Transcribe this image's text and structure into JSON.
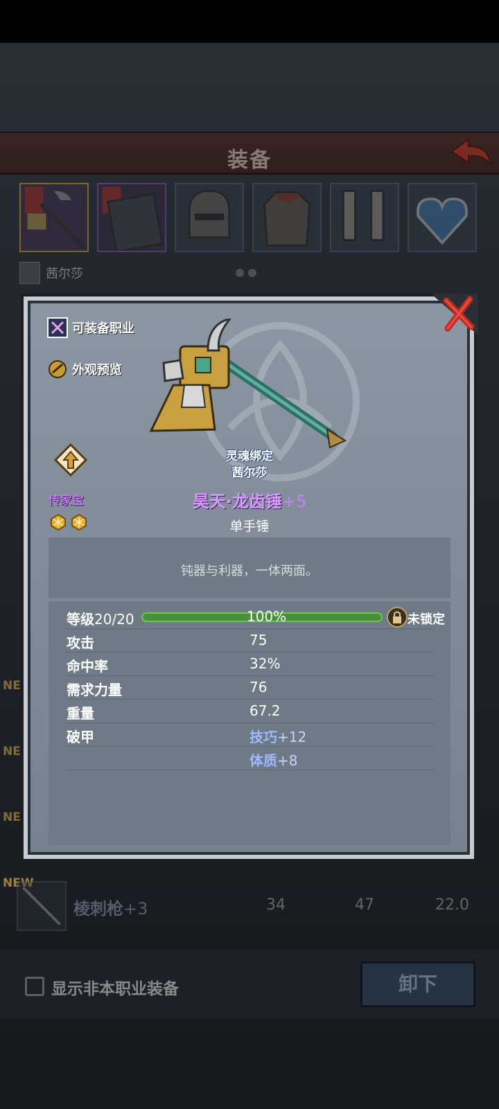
{
  "header": {
    "title": "装备"
  },
  "owner": {
    "name": "茜尔莎"
  },
  "slots": [
    {
      "name": "hammer-slot"
    },
    {
      "name": "book-slot"
    },
    {
      "name": "helmet-slot"
    },
    {
      "name": "armor-slot"
    },
    {
      "name": "boots-slot"
    },
    {
      "name": "amulet-slot"
    }
  ],
  "list": {
    "new_tags": [
      "NEW",
      "NEW",
      "NEW",
      "NEW"
    ],
    "item": {
      "name": "棱刺枪",
      "enh": "+3",
      "v1": "34",
      "v2": "47",
      "v3": "22.0"
    }
  },
  "footer": {
    "checkbox_label": "显示非本职业装备",
    "unequip_label": "卸下"
  },
  "modal": {
    "links": {
      "class_label": "可装备职业",
      "preview_label": "外观预览"
    },
    "bind": {
      "line1": "灵魂绑定",
      "line2": "茜尔莎"
    },
    "rarity": "传家宝",
    "stars": 2,
    "weapon": {
      "name": "昊天·龙齿锤",
      "enh": "+5",
      "type": "单手锤"
    },
    "description": "钝器与利器，一体两面。",
    "level": {
      "label": "等级",
      "value": "20/20",
      "percent": "100%",
      "progress": 1.0,
      "lock_text": "未锁定"
    },
    "stats": [
      {
        "label": "攻击",
        "value": "75"
      },
      {
        "label": "命中率",
        "value": "32%"
      },
      {
        "label": "需求力量",
        "value": "76"
      },
      {
        "label": "重量",
        "value": "67.2"
      }
    ],
    "bonus": {
      "label": "破甲",
      "items": [
        {
          "name": "技巧",
          "plus": "+12"
        },
        {
          "name": "体质",
          "plus": "+8"
        }
      ]
    }
  },
  "colors": {
    "legendary": "#c27cf2",
    "bind": "#2b4d8a",
    "bar": "#4a8f3c"
  }
}
